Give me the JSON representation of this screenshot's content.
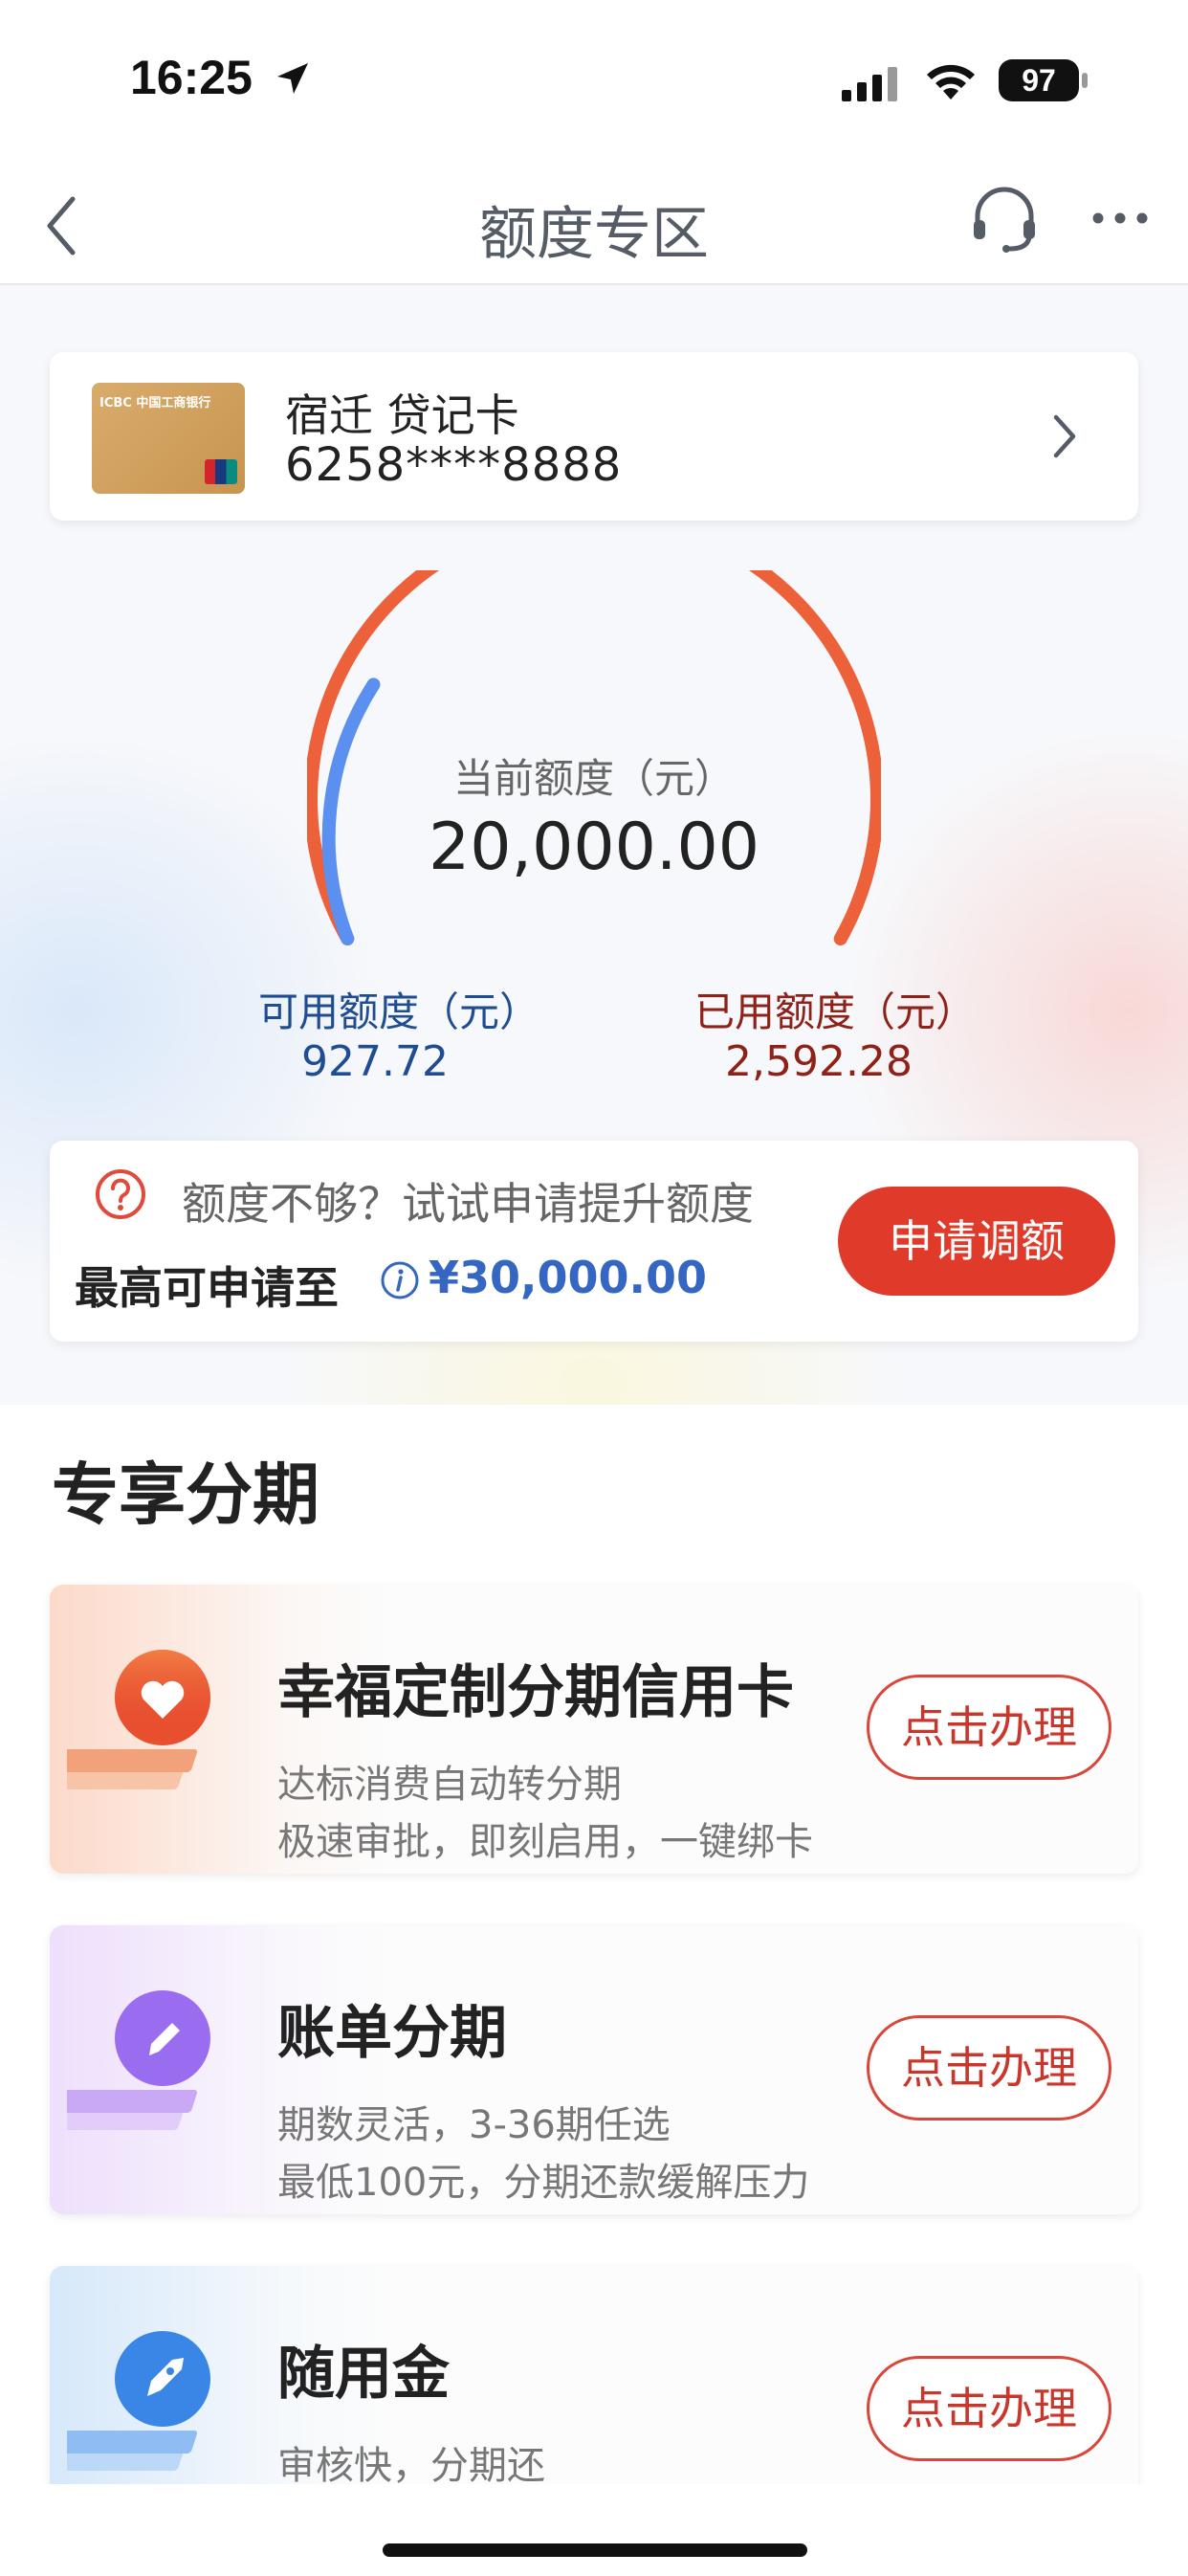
{
  "status_bar": {
    "time": "16:25",
    "battery": "97"
  },
  "nav": {
    "title": "额度专区"
  },
  "card": {
    "name": "宿迁 贷记卡",
    "number": "6258****8888",
    "bank_text": "ICBC 中国工商银行"
  },
  "gauge": {
    "label": "当前额度（元）",
    "value": "20,000.00",
    "available_label": "可用额度（元）",
    "available_value": "927.72",
    "used_label": "已用额度（元）",
    "used_value": "2,592.28",
    "used_color": "#ec6139",
    "available_color": "#5b8ff0"
  },
  "raise": {
    "prompt": "额度不够？试试申请提升额度",
    "max_label": "最高可申请至",
    "max_amount": "¥30,000.00",
    "button": "申请调额",
    "accent": "#e03a2b"
  },
  "section": {
    "title": "专享分期",
    "items": [
      {
        "title": "幸福定制分期信用卡",
        "desc1": "达标消费自动转分期",
        "desc2": "极速审批，即刻启用，一键绑卡",
        "button": "点击办理",
        "icon": "heart-icon"
      },
      {
        "title": "账单分期",
        "desc1": "期数灵活，3-36期任选",
        "desc2": "最低100元，分期还款缓解压力",
        "button": "点击办理",
        "icon": "pencil-icon"
      },
      {
        "title": "随用金",
        "desc1": "审核快，分期还",
        "button": "点击办理",
        "icon": "rocket-icon"
      }
    ]
  }
}
